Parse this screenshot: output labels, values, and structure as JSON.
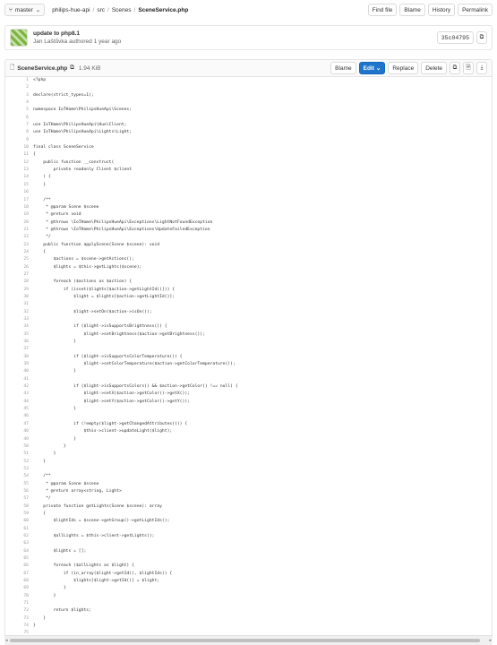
{
  "header": {
    "branch": "master",
    "breadcrumb": [
      "philips-hue-api",
      "src",
      "Scenes",
      "SceneService.php"
    ],
    "buttons": [
      "Find file",
      "Blame",
      "History",
      "Permalink"
    ]
  },
  "commit": {
    "title": "update to php8.1",
    "author": "Jan Laštůvka authored 1 year ago",
    "sha": "35c04795"
  },
  "file": {
    "name": "SceneService.php",
    "size": "1.94 KiB",
    "blame": "Blame",
    "edit": "Edit",
    "replace": "Replace",
    "delete": "Delete"
  },
  "code_lines": [
    "<?php",
    "",
    "declare(strict_types=1);",
    "",
    "namespace IoTHome\\PhilipsHueApi\\Scenes;",
    "",
    "use IoTHome\\PhilipsHueApi\\Hue\\Client;",
    "use IoTHome\\PhilipsHueApi\\Lights\\Light;",
    "",
    "final class SceneService",
    "{",
    "    public function __construct(",
    "        private readonly Client $client",
    "    ) {",
    "    }",
    "",
    "    /**",
    "     * @param Scene $scene",
    "     * @return void",
    "     * @throws \\IoTHome\\PhilipsHueApi\\Exceptions\\LightNotFoundException",
    "     * @throws \\IoTHome\\PhilipsHueApi\\Exceptions\\UpdateFailedException",
    "     */",
    "    public function applyScene(Scene $scene): void",
    "    {",
    "        $actions = $scene->getActions();",
    "        $lights = $this->getLights($scene);",
    "",
    "        foreach ($actions as $action) {",
    "            if (isset($lights[$action->getLightId()])) {",
    "                $light = $lights[$action->getLightId()];",
    "",
    "                $light->setOn($action->isOn());",
    "",
    "                if ($light->isSupportsBrightness()) {",
    "                    $light->setBrightness($action->getBrightness());",
    "                }",
    "",
    "                if ($light->isSupportsColorTemperature()) {",
    "                    $light->setColorTemperature($action->getColorTemperature());",
    "                }",
    "",
    "                if ($light->isSupportsColors() && $action->getColor() !== null) {",
    "                    $light->setX($action->getColor()->getX());",
    "                    $light->setY($action->getColor()->getY());",
    "                }",
    "",
    "                if (!empty($light->getChangedAttributes())) {",
    "                    $this->client->updateLight($light);",
    "                }",
    "            }",
    "        }",
    "    }",
    "",
    "    /**",
    "     * @param Scene $scene",
    "     * @return array<string, Light>",
    "     */",
    "    private function getLights(Scene $scene): array",
    "    {",
    "        $lightIds = $scene->getGroup()->getLightIds();",
    "",
    "        $allLights = $this->client->getLights();",
    "",
    "        $lights = [];",
    "",
    "        foreach ($allLights as $light) {",
    "            if (in_array($light->getId(), $lightIds)) {",
    "                $lights[$light->getId()] = $light;",
    "            }",
    "        }",
    "",
    "        return $lights;",
    "    }",
    "}",
    ""
  ]
}
